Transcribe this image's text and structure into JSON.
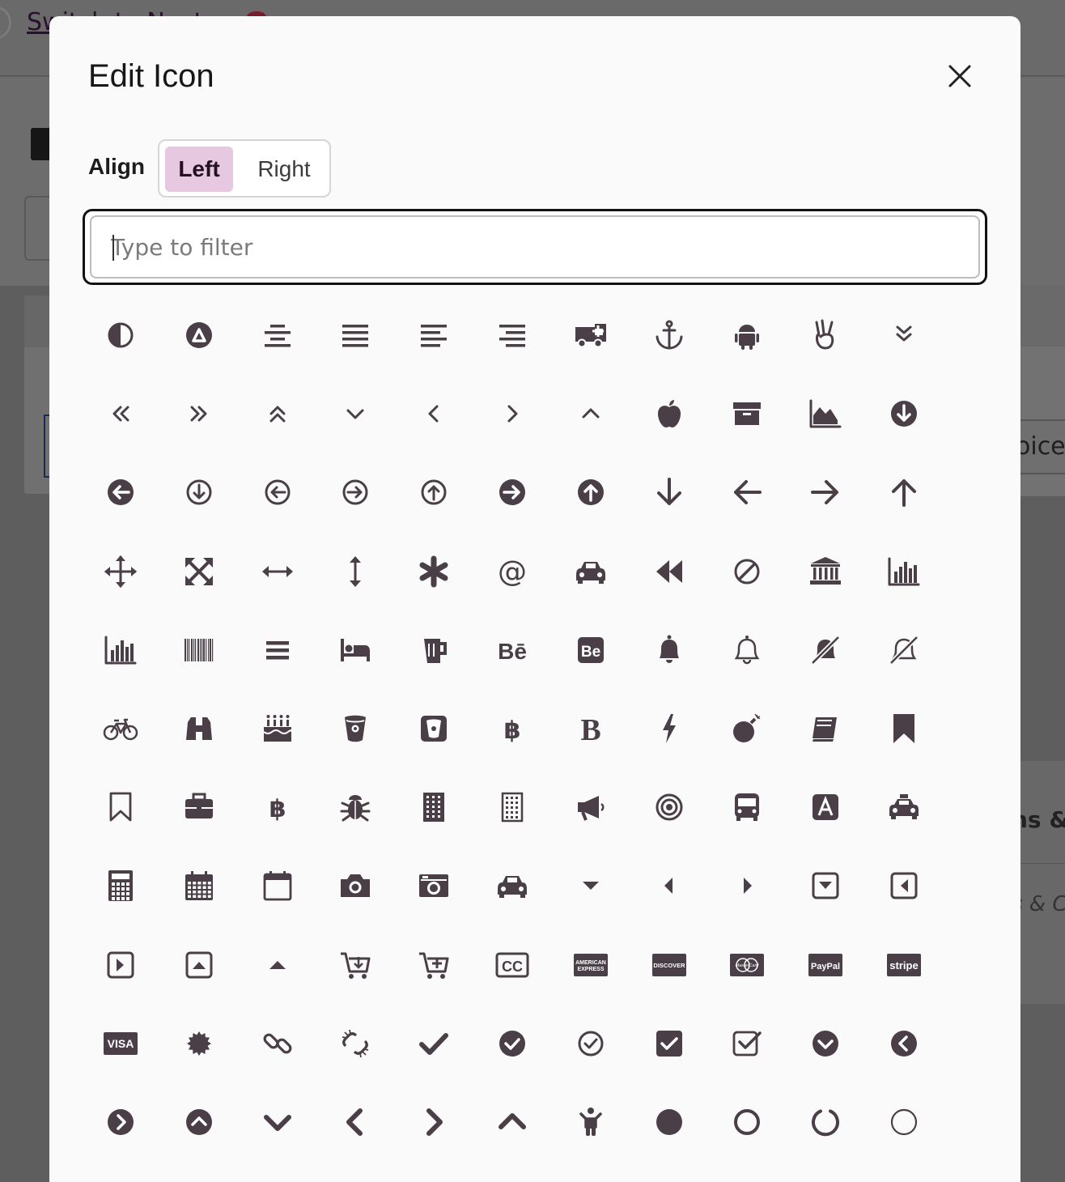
{
  "background": {
    "link_text": "Switch to Next",
    "right_text_1": "oice",
    "right_text_2": "ns &",
    "right_text_3": "s & C"
  },
  "modal": {
    "title": "Edit Icon",
    "close_icon": "close-icon",
    "align": {
      "label": "Align",
      "options": [
        "Left",
        "Right"
      ],
      "selected": "Left"
    },
    "filter": {
      "placeholder": "Type to filter",
      "value": ""
    },
    "icon_color": "#4a3f47",
    "selected_color": "#e6c8e0",
    "icons": [
      "adjust",
      "adn",
      "align-center",
      "align-justify",
      "align-left",
      "align-right",
      "ambulance",
      "anchor",
      "android",
      "angellist",
      "angle-double-down",
      "angle-double-left",
      "angle-double-right",
      "angle-double-up",
      "angle-down",
      "angle-left",
      "angle-right",
      "angle-up",
      "apple",
      "archive",
      "area-chart",
      "arrow-circle-down",
      "arrow-circle-left",
      "arrow-circle-o-down",
      "arrow-circle-o-left",
      "arrow-circle-o-right",
      "arrow-circle-o-up",
      "arrow-circle-right",
      "arrow-circle-up",
      "arrow-down",
      "arrow-left",
      "arrow-right",
      "arrow-up",
      "arrows",
      "arrows-alt",
      "arrows-h",
      "arrows-v",
      "asterisk",
      "at",
      "automobile",
      "backward",
      "ban",
      "bank",
      "bar-chart",
      "bar-chart-o",
      "barcode",
      "bars",
      "bed",
      "beer",
      "behance",
      "behance-square",
      "bell",
      "bell-o",
      "bell-slash",
      "bell-slash-o",
      "bicycle",
      "binoculars",
      "birthday-cake",
      "bitbucket",
      "bitbucket-square",
      "bitcoin",
      "bold",
      "bolt",
      "bomb",
      "book",
      "bookmark",
      "bookmark-o",
      "briefcase",
      "btc",
      "bug",
      "building",
      "building-o",
      "bullhorn",
      "bullseye",
      "bus",
      "buysellads",
      "cab",
      "calculator",
      "calendar",
      "calendar-o",
      "camera",
      "camera-retro",
      "car",
      "caret-down",
      "caret-left",
      "caret-right",
      "caret-square-o-down",
      "caret-square-o-left",
      "caret-square-o-right",
      "caret-square-o-up",
      "caret-up",
      "cart-arrow-down",
      "cart-plus",
      "cc",
      "cc-amex",
      "cc-discover",
      "cc-mastercard",
      "cc-paypal",
      "cc-stripe",
      "cc-visa",
      "certificate",
      "chain",
      "chain-broken",
      "check",
      "check-circle",
      "check-circle-o",
      "check-square",
      "check-square-o",
      "chevron-circle-down",
      "chevron-circle-left",
      "chevron-circle-right",
      "chevron-circle-up",
      "chevron-down",
      "chevron-left",
      "chevron-right",
      "chevron-up",
      "child",
      "circle",
      "circle-o",
      "circle-o-notch",
      "circle-thin"
    ],
    "icon_labels": {
      "behance": "Bē",
      "behance-square": "Be",
      "bold": "B",
      "cc-amex": "AMERICAN EXPRESS",
      "cc-discover": "DISCOVER",
      "cc-mastercard": "MasterCard",
      "cc-paypal": "PayPal",
      "cc-stripe": "stripe",
      "cc-visa": "VISA",
      "at": "@"
    }
  }
}
